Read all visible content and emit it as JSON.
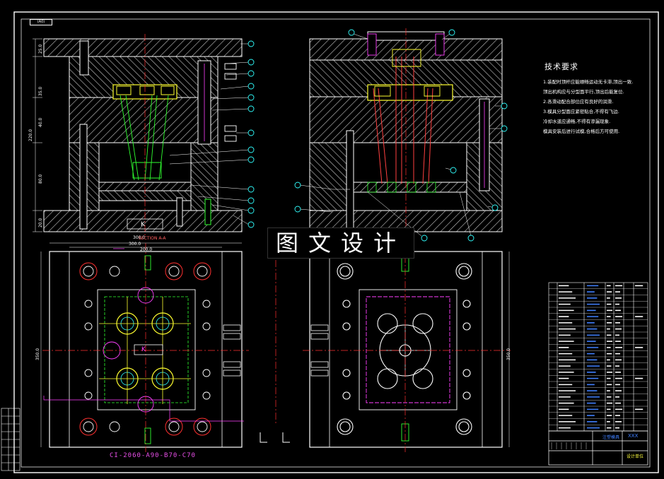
{
  "drawing": {
    "corner_tag": "(A0)",
    "watermark": "图文设计",
    "section_label": "SECTION A-A",
    "mold_code": "CI-2060-A90-B70-C70",
    "stamp_left": "K",
    "stamp_center": "K"
  },
  "technical_requirements": {
    "title": "技术要求",
    "lines": [
      "1.装配时顶杆应能顺畅运动无卡滞,顶出一致.",
      "顶出机构应与分型面平行,顶出后能复位.",
      "2.各滑动配合部位应有良好的润滑.",
      "3.模具分型面应紧密贴合,不得有飞边.",
      "冷却水道应通畅,不得有渗漏现象.",
      "模具安装后进行试模,合格后方可使用."
    ]
  },
  "dimensions": {
    "top_width": "300.0",
    "plan_width": "200.0",
    "plan_height": "350.0",
    "right_height": "350.0",
    "left_heights": [
      "25.0",
      "35.0",
      "40.0",
      "220.0",
      "80.0",
      "20.0"
    ]
  },
  "title_block": {
    "name_cell": "XXX",
    "drawing_name": "注塑模具",
    "school": "设计单位"
  },
  "colors": {
    "outline": "#ffffff",
    "center_line": "#ff3030",
    "yellow": "#ffff30",
    "green": "#30ff30",
    "cyan": "#30ffff",
    "magenta": "#ff40ff",
    "blue": "#4080ff"
  }
}
